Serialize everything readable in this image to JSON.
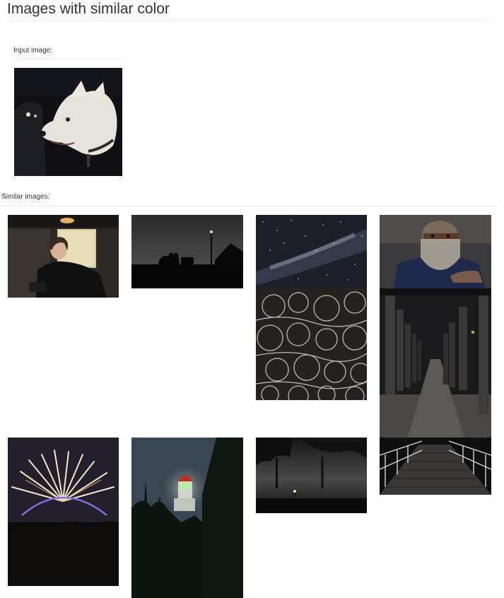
{
  "page": {
    "title": "Images with similar color"
  },
  "input_section": {
    "label": "Input image:"
  },
  "similar_section": {
    "label": "Similar images:"
  }
}
